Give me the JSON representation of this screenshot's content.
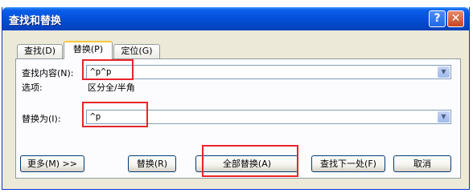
{
  "window": {
    "title": "查找和替换",
    "help_glyph": "?",
    "close_glyph": "✕"
  },
  "tabs": {
    "find": "查找(D)",
    "replace": "替换(P)",
    "goto": "定位(G)"
  },
  "find_field": {
    "label": "查找内容(N):",
    "value": "^p^p"
  },
  "options": {
    "label": "选项:",
    "value": "区分全/半角"
  },
  "replace_field": {
    "label": "替换为(I):",
    "value": "^p"
  },
  "buttons": {
    "more": "更多(M) >>",
    "replace": "替换(R)",
    "replace_all": "全部替换(A)",
    "find_next": "查找下一处(F)",
    "cancel": "取消"
  },
  "colors": {
    "highlight_box": "#e8242a",
    "titlebar": "#0653df"
  }
}
